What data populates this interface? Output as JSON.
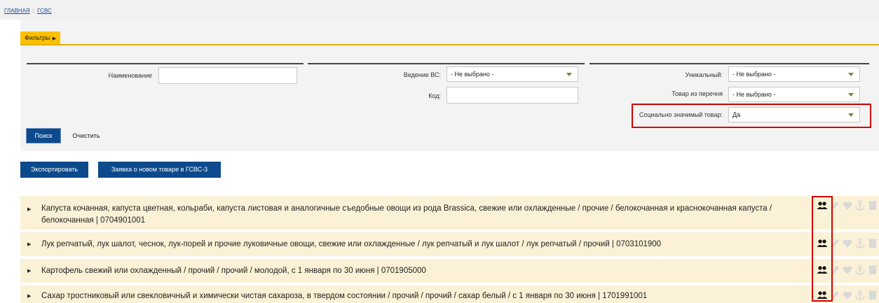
{
  "breadcrumb": {
    "home": "ГЛАВНАЯ",
    "separator": "::",
    "current": "ГСВС"
  },
  "filters": {
    "tab_label": "Фильтры",
    "name_label": "Наименование",
    "name_value": "",
    "vedenie_label": "Ведение ВС:",
    "vedenie_value": "- Не выбрано -",
    "kod_label": "Код:",
    "kod_value": "",
    "unique_label": "Уникальный:",
    "unique_value": "- Не выбрано -",
    "perechen_label": "Товар из перечня",
    "perechen_value": "- Не выбрано -",
    "social_label": "Социально значимый товар:",
    "social_value": "Да",
    "search_button": "Поиск",
    "clear_button": "Очистить"
  },
  "actions": {
    "export_button": "Экспортировать",
    "request_button": "Заявка о новом товаре в ГСВС-3"
  },
  "icons": [
    "users-icon",
    "edit-icon",
    "diamond-icon",
    "anchor-icon",
    "trash-icon"
  ],
  "colors": {
    "accent": "#ffc000",
    "primary": "#0d4a8c",
    "highlight": "#d30000",
    "row_bg": "#fbf1d6"
  },
  "results": [
    {
      "text": "Капуста кочанная, капуста цветная, кольраби, капуста листовая и аналогичные съедобные овощи из рода Brassica, свежие или охлажденные / прочие / белокочанная и краснокочанная капуста / белокочанная | 0704901001"
    },
    {
      "text": "Лук репчатый, лук шалот, чеснок, лук-порей и прочие луковичные овощи, свежие или охлажденные / лук репчатый и лук шалот / лук репчатый / прочий | 0703101900"
    },
    {
      "text": "Картофель свежий или охлажденный / прочий / прочий / молодой, с 1 января по 30 июня | 0701905000"
    },
    {
      "text": "Сахар тростниковый или свекловичный и химически чистая сахароза, в твердом состоянии / прочий / прочий / сахар белый / с 1 января по 30 июня | 1701991001"
    }
  ]
}
